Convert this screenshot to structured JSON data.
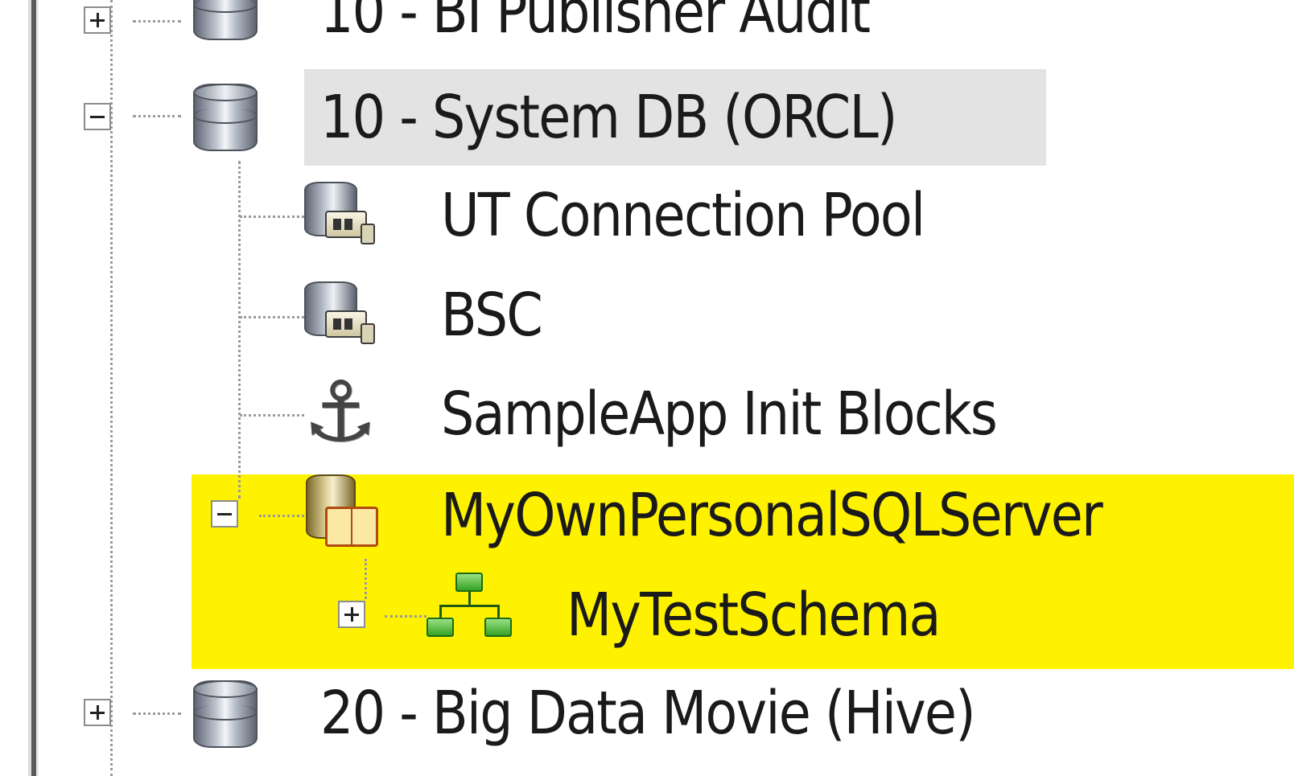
{
  "tree": {
    "items": [
      {
        "label": "10 - BI Publisher Audit",
        "expander": "plus",
        "icon": "database-icon"
      },
      {
        "label": "10 - System DB (ORCL)",
        "expander": "minus",
        "icon": "database-icon",
        "selected": true
      },
      {
        "label": "UT Connection Pool",
        "icon": "connection-pool-icon"
      },
      {
        "label": "BSC",
        "icon": "connection-pool-icon"
      },
      {
        "label": "SampleApp Init Blocks",
        "icon": "anchor-icon"
      },
      {
        "label": "MyOwnPersonalSQLServer",
        "expander": "minus",
        "icon": "sql-server-database-icon",
        "highlighted": true
      },
      {
        "label": "MyTestSchema",
        "expander": "plus",
        "icon": "schema-icon",
        "highlighted": true
      },
      {
        "label": "20 - Big Data Movie (Hive)",
        "expander": "plus",
        "icon": "database-icon"
      }
    ]
  },
  "colors": {
    "highlight": "#fff200",
    "selection": "#e3e3e3",
    "text": "#1a1a1a"
  }
}
